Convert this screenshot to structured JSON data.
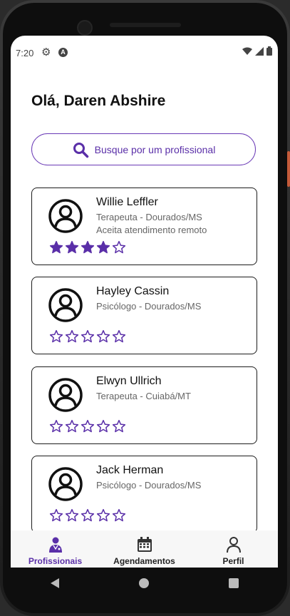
{
  "status_bar": {
    "time": "7:20",
    "icons": [
      "gear-icon",
      "a-badge-icon",
      "wifi-icon",
      "signal-icon",
      "battery-icon"
    ]
  },
  "greeting": "Olá, Daren Abshire",
  "search": {
    "placeholder": "Busque por um profissional",
    "icon": "search-icon"
  },
  "colors": {
    "accent": "#5a2fa8",
    "border": "#6a3ab6"
  },
  "professionals": [
    {
      "name": "Willie Leffler",
      "role": "Terapeuta - Dourados/MS",
      "remote": "Aceita atendimento remoto",
      "rating": 4,
      "max_rating": 5
    },
    {
      "name": "Hayley Cassin",
      "role": "Psicólogo - Dourados/MS",
      "remote": "",
      "rating": 0,
      "max_rating": 5
    },
    {
      "name": "Elwyn Ullrich",
      "role": "Terapeuta - Cuiabá/MT",
      "remote": "",
      "rating": 0,
      "max_rating": 5
    },
    {
      "name": "Jack Herman",
      "role": "Psicólogo - Dourados/MS",
      "remote": "",
      "rating": 0,
      "max_rating": 5
    }
  ],
  "bottom_nav": {
    "items": [
      {
        "label": "Profissionais",
        "icon": "doctor-icon",
        "active": true
      },
      {
        "label": "Agendamentos",
        "icon": "calendar-icon",
        "active": false
      },
      {
        "label": "Perfil",
        "icon": "person-icon",
        "active": false
      }
    ]
  }
}
